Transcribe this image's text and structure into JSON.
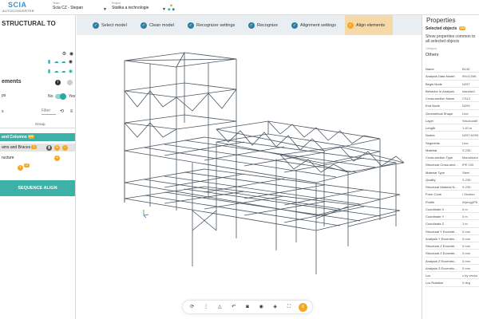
{
  "app": {
    "brand": "SCIA",
    "brand_sub": "AUTOCONVERTER"
  },
  "header": {
    "team_label": "Team",
    "team_value": "Scia CZ - Stepan",
    "project_label": "Project",
    "project_value": "Statika a technologie"
  },
  "left_panel": {
    "title": "STRUCTURAL TO",
    "section_title": "ements",
    "toggle_label": "ps",
    "toggle_no": "No",
    "toggle_yes": "Yes",
    "filter_label": "s",
    "filter_placeholder": "Filter",
    "group_header": "Group",
    "groups": [
      {
        "label": "and Columns",
        "badge": "103"
      },
      {
        "label": "ams and Braces",
        "badge": "1"
      },
      {
        "label": "ructure",
        "badge": ""
      }
    ],
    "add_badge": "12",
    "sequence_button": "SEQUENCE ALIGN"
  },
  "steps": [
    {
      "label": "Select model"
    },
    {
      "label": "Clean model"
    },
    {
      "label": "Recognizer settings"
    },
    {
      "label": "Recognize"
    },
    {
      "label": "Alignment settings"
    },
    {
      "label": "Align elements"
    }
  ],
  "right_panel": {
    "title": "Properties",
    "selected_objects_label": "Selected objects",
    "selected_objects_count": "103",
    "show_props_text": "Show properties common to all selected objects",
    "category_label": "Category",
    "category_value": "Others",
    "properties": [
      {
        "key": "Name",
        "value": "B145"
      },
      {
        "key": "Analysis Data Model",
        "value": "99c113d9-"
      },
      {
        "key": "Begin Node",
        "value": "N297"
      },
      {
        "key": "Behavior In Analysis",
        "value": "standard"
      },
      {
        "key": "Cross-section Name",
        "value": "CS12"
      },
      {
        "key": "End Node",
        "value": "N299"
      },
      {
        "key": "Geometrical Shape",
        "value": "Line"
      },
      {
        "key": "Layer",
        "value": "StructuralE"
      },
      {
        "key": "Length",
        "value": "1.40 m"
      },
      {
        "key": "Nodes",
        "value": "N297;N299"
      },
      {
        "key": "Segments",
        "value": "Line"
      },
      {
        "key": "Material",
        "value": "S 235"
      },
      {
        "key": "Cross-section Type",
        "value": "Manufactur"
      },
      {
        "key": "Structural Cross-sect...",
        "value": "IPE 100"
      },
      {
        "key": "Material Type",
        "value": "Steel"
      },
      {
        "key": "Quality",
        "value": "S 235"
      },
      {
        "key": "Structural Material N...",
        "value": "S 235"
      },
      {
        "key": "Form Code",
        "value": "I Section"
      },
      {
        "key": "Profile",
        "value": "W(eng)IPE"
      },
      {
        "key": "Coordinate X",
        "value": "0 m"
      },
      {
        "key": "Coordinate Y",
        "value": "0 m"
      },
      {
        "key": "Coordinate Z",
        "value": "1 m"
      },
      {
        "key": "Structural Y Eccentri...",
        "value": "0 mm"
      },
      {
        "key": "Analysis Y Eccentric...",
        "value": "0 mm"
      },
      {
        "key": "Structural Z Eccentri...",
        "value": "0 mm"
      },
      {
        "key": "Structural Z Eccentri...",
        "value": "0 mm"
      },
      {
        "key": "Analysis Z Eccentric...",
        "value": "0 mm"
      },
      {
        "key": "Analysis Z Eccentric...",
        "value": "0 mm"
      },
      {
        "key": "Lcs",
        "value": "z by vector"
      },
      {
        "key": "Lcs Rotation",
        "value": "0 deg"
      }
    ]
  }
}
